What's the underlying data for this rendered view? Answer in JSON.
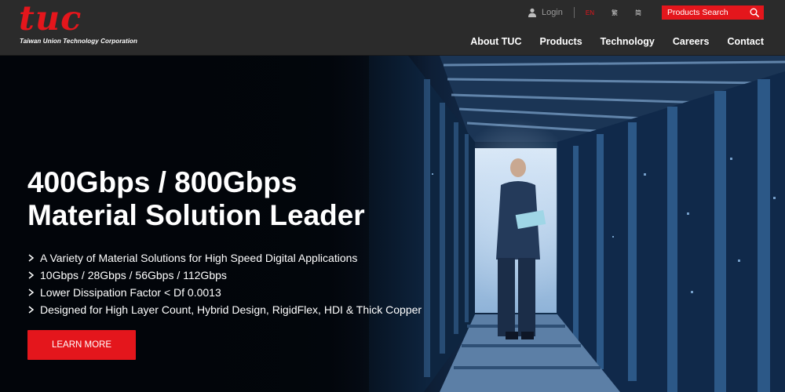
{
  "brand": {
    "logo_text": "tuc",
    "company_name": "Taiwan Union Technology Corporation",
    "accent_color": "#e4161c"
  },
  "utility": {
    "login_label": "Login",
    "languages": [
      {
        "label": "EN",
        "active": true
      },
      {
        "label": "繁",
        "active": false
      },
      {
        "label": "简",
        "active": false
      }
    ],
    "search_placeholder": "Products Search",
    "icons": [
      "user-icon",
      "search-icon"
    ]
  },
  "nav": {
    "items": [
      "About TUC",
      "Products",
      "Technology",
      "Careers",
      "Contact"
    ]
  },
  "hero": {
    "title_line1": "400Gbps / 800Gbps",
    "title_line2": "Material Solution Leader",
    "bullets": [
      "A Variety of Material Solutions for High Speed Digital Applications",
      "10Gbps / 28Gbps / 56Gbps / 112Gbps",
      "Lower Dissipation Factor < Df 0.0013",
      "Designed for High Layer Count, Hybrid Design, RigidFlex, HDI & Thick Copper"
    ],
    "cta_label": "LEARN MORE",
    "background": "server-room-photo"
  }
}
